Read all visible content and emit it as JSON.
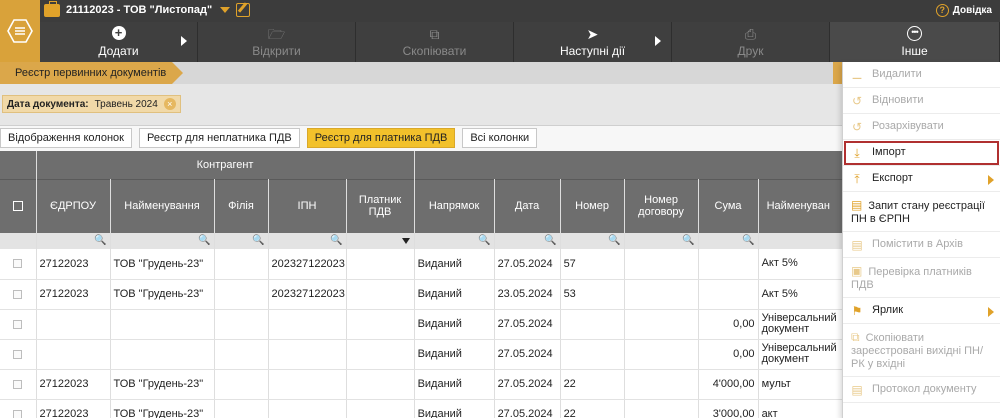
{
  "header": {
    "company_title": "21112023 - ТОВ \"Листопад\"",
    "help_label": "Довідка"
  },
  "toolbar": {
    "add_label": "Додати",
    "open_label": "Відкрити",
    "copy_label": "Скопіювати",
    "next_actions_label": "Наступні дії",
    "print_label": "Друк",
    "other_label": "Інше"
  },
  "breadcrumb": {
    "registry_label": "Реєстр первинних документів"
  },
  "filter": {
    "date_label": "Дата документа:",
    "date_value": "Травень 2024"
  },
  "view_buttons": [
    {
      "label": "Відображення колонок",
      "active": false
    },
    {
      "label": "Реєстр для неплатника ПДВ",
      "active": false
    },
    {
      "label": "Реєстр для платника ПДВ",
      "active": true
    },
    {
      "label": "Всі колонки",
      "active": false
    }
  ],
  "table": {
    "group_header": "Контрагент",
    "columns": [
      "ЄДРПОУ",
      "Найменування",
      "Філія",
      "ІПН",
      "Платник ПДВ",
      "Напрямок",
      "Дата",
      "Номер",
      "Номер договору",
      "Сума",
      "Найменуван"
    ],
    "rows": [
      [
        "27122023",
        "ТОВ \"Грудень-23\"",
        "",
        "202327122023",
        "",
        "Виданий",
        "27.05.2024",
        "57",
        "",
        "",
        "Акт 5%"
      ],
      [
        "27122023",
        "ТОВ \"Грудень-23\"",
        "",
        "202327122023",
        "",
        "Виданий",
        "23.05.2024",
        "53",
        "",
        "",
        "Акт 5%"
      ],
      [
        "",
        "",
        "",
        "",
        "",
        "Виданий",
        "27.05.2024",
        "",
        "",
        "0,00",
        "Універсальний документ"
      ],
      [
        "",
        "",
        "",
        "",
        "",
        "Виданий",
        "27.05.2024",
        "",
        "",
        "0,00",
        "Універсальний документ"
      ],
      [
        "27122023",
        "ТОВ \"Грудень-23\"",
        "",
        "",
        "",
        "Виданий",
        "27.05.2024",
        "22",
        "",
        "4'000,00",
        "мульт"
      ],
      [
        "27122023",
        "ТОВ \"Грудень-23\"",
        "",
        "",
        "",
        "Виданий",
        "27.05.2024",
        "22",
        "",
        "3'000,00",
        "акт"
      ]
    ]
  },
  "menu": {
    "items": [
      {
        "label": "Видалити",
        "icon": "minus-circle-icon",
        "disabled": true
      },
      {
        "label": "Відновити",
        "icon": "restore-icon",
        "disabled": true
      },
      {
        "label": "Розархівувати",
        "icon": "unarchive-icon",
        "disabled": true
      },
      {
        "label": "Імпорт",
        "icon": "import-icon",
        "disabled": false,
        "highlighted": true
      },
      {
        "label": "Експорт",
        "icon": "export-icon",
        "disabled": false,
        "submenu": true
      },
      {
        "label": "Запит стану реєстрації ПН в ЄРПН",
        "icon": "request-icon",
        "disabled": false
      },
      {
        "label": "Помістити в Архів",
        "icon": "archive-icon",
        "disabled": true
      },
      {
        "label": "Перевірка платників ПДВ",
        "icon": "check-payers-icon",
        "disabled": true
      },
      {
        "label": "Ярлик",
        "icon": "tag-icon",
        "disabled": false,
        "submenu": true
      },
      {
        "label": "Скопіювати зареєстровані вихідні ПН/РК у вхідні",
        "icon": "copy-icon",
        "disabled": true
      },
      {
        "label": "Протокол документу",
        "icon": "protocol-icon",
        "disabled": true
      }
    ]
  },
  "colors": {
    "accent": "#e0a22a",
    "active_button": "#f2c12b",
    "header_bg": "#3c3c3c",
    "table_header_bg": "#6e6e6e",
    "highlight_outline": "#b03030"
  }
}
